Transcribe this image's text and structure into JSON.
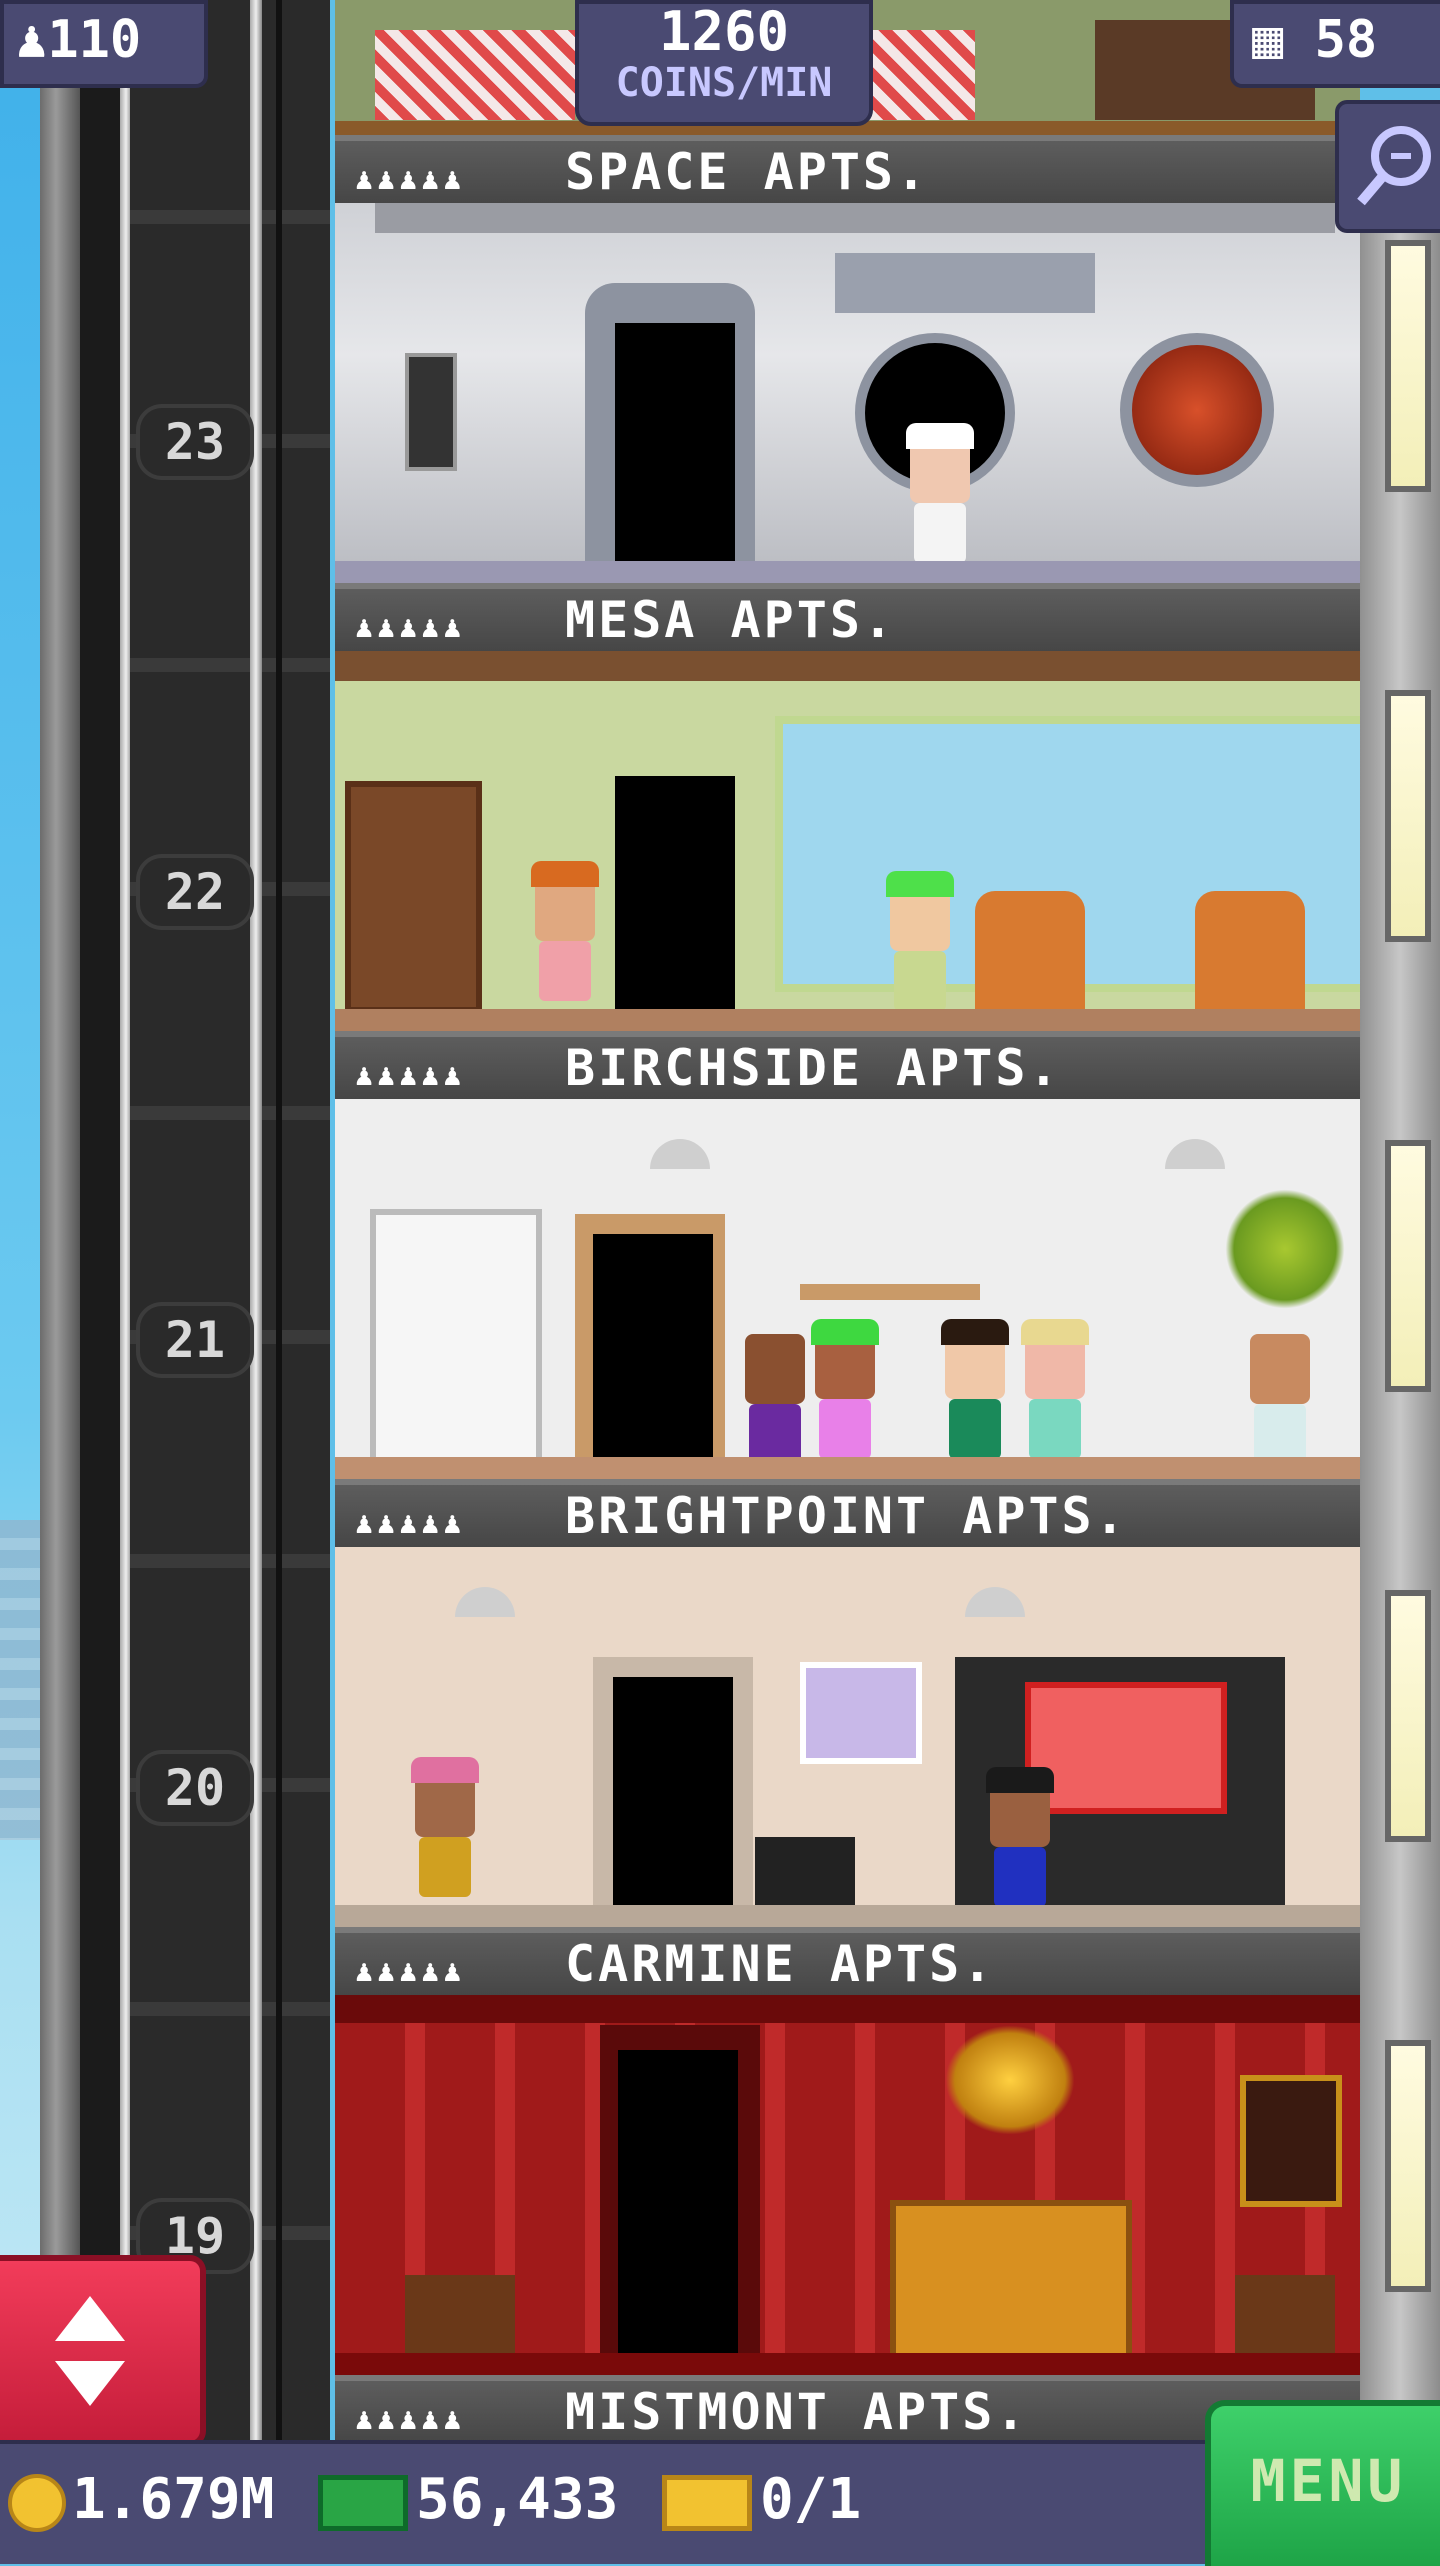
{
  "hud": {
    "population": "110",
    "coins_per_min_value": "1260",
    "coins_per_min_unit": "COINS/MIN",
    "floors": "58"
  },
  "floors": [
    {
      "number": "23",
      "name": "SPACE APTS.",
      "people": "♟♟♟♟♟"
    },
    {
      "number": "22",
      "name": "MESA APTS.",
      "people": "♟♟♟♟♟"
    },
    {
      "number": "21",
      "name": "BIRCHSIDE APTS.",
      "people": "♟♟♟♟♟"
    },
    {
      "number": "20",
      "name": "BRIGHTPOINT APTS.",
      "people": "♟♟♟♟♟"
    },
    {
      "number": "19",
      "name": "CARMINE APTS.",
      "people": "♟♟♟♟♟"
    },
    {
      "number": "",
      "name": "MISTMONT APTS.",
      "people": "♟♟♟♟♟"
    }
  ],
  "bottom": {
    "coins": "1.679M",
    "bux": "56,433",
    "vip": "0/1",
    "menu_label": "MENU"
  },
  "icons": {
    "population": "person-icon",
    "floors": "building-icon",
    "search": "magnifier-icon",
    "elevator": "up-down-arrows-icon",
    "coins": "coin-icon",
    "bux": "tower-bux-icon",
    "vip": "vip-ticket-icon"
  },
  "colors": {
    "hud_bg": "#4a4a72",
    "menu_green": "#2fbe58",
    "elevator_red": "#e52a48",
    "carmine_red": "#a01a1a"
  }
}
